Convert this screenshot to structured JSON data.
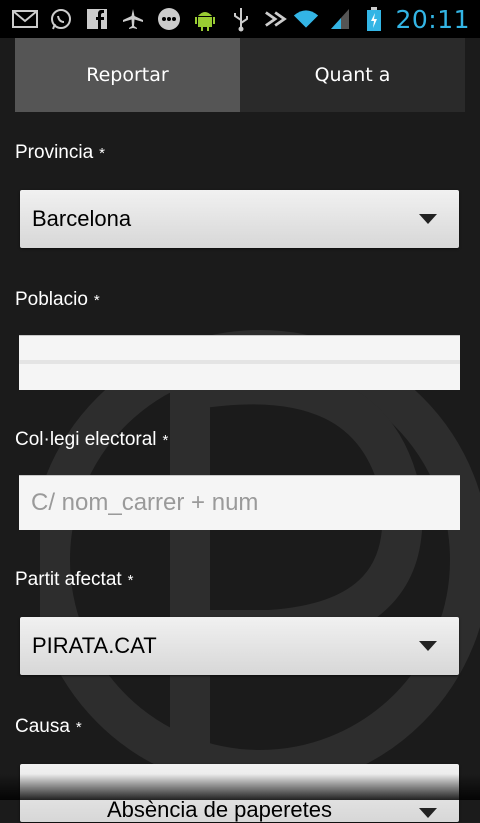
{
  "status": {
    "time": "20:11"
  },
  "tabs": [
    {
      "label": "Reportar",
      "active": true
    },
    {
      "label": "Quant a",
      "active": false
    }
  ],
  "form": {
    "provincia": {
      "label": "Provincia",
      "required": "*",
      "value": "Barcelona"
    },
    "poblacio": {
      "label": "Poblacio",
      "required": "*",
      "value": ""
    },
    "collegi": {
      "label": "Col·legi electoral",
      "required": "*",
      "placeholder": "C/ nom_carrer + num"
    },
    "partit": {
      "label": "Partit afectat",
      "required": "*",
      "value": "PIRATA.CAT"
    },
    "causa": {
      "label": "Causa",
      "required": "*",
      "value": "Absència de paperetes"
    }
  },
  "colors": {
    "accent": "#33b5e5",
    "background": "#1b1b1b",
    "tab_active": "#555555"
  }
}
